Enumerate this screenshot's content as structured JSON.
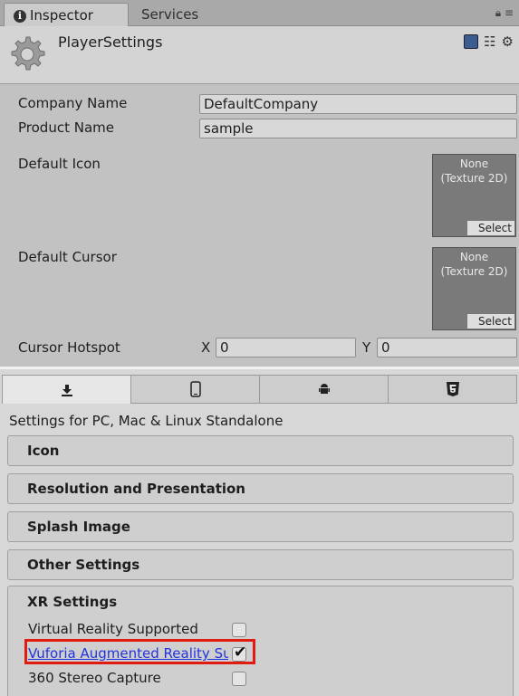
{
  "tabs": {
    "inspector": "Inspector",
    "services": "Services"
  },
  "header": {
    "title": "PlayerSettings"
  },
  "fields": {
    "company_name_label": "Company Name",
    "company_name_value": "DefaultCompany",
    "product_name_label": "Product Name",
    "product_name_value": "sample",
    "default_icon_label": "Default Icon",
    "default_cursor_label": "Default Cursor",
    "texture_none": "None",
    "texture_type": "(Texture 2D)",
    "select_label": "Select",
    "cursor_hotspot_label": "Cursor Hotspot",
    "x_label": "X",
    "x_value": "0",
    "y_label": "Y",
    "y_value": "0"
  },
  "platform": {
    "settings_for": "Settings for PC, Mac & Linux Standalone",
    "sections": [
      "Icon",
      "Resolution and Presentation",
      "Splash Image",
      "Other Settings"
    ],
    "xr": {
      "title": "XR Settings",
      "vr_supported": "Virtual Reality Supported",
      "vuforia": "Vuforia Augmented Reality Supported",
      "stereo_capture": "360 Stereo Capture"
    }
  },
  "icons": [
    "info-icon",
    "lock-icon",
    "menu-icon",
    "gear-icon",
    "book-icon",
    "sliders-icon",
    "download-icon",
    "phone-icon",
    "android-icon",
    "html5-icon"
  ],
  "state": {
    "vr_supported": false,
    "vuforia_supported": true,
    "stereo_capture": false
  },
  "colors": {
    "highlight": "#e01b0f",
    "link": "#2233dd"
  }
}
